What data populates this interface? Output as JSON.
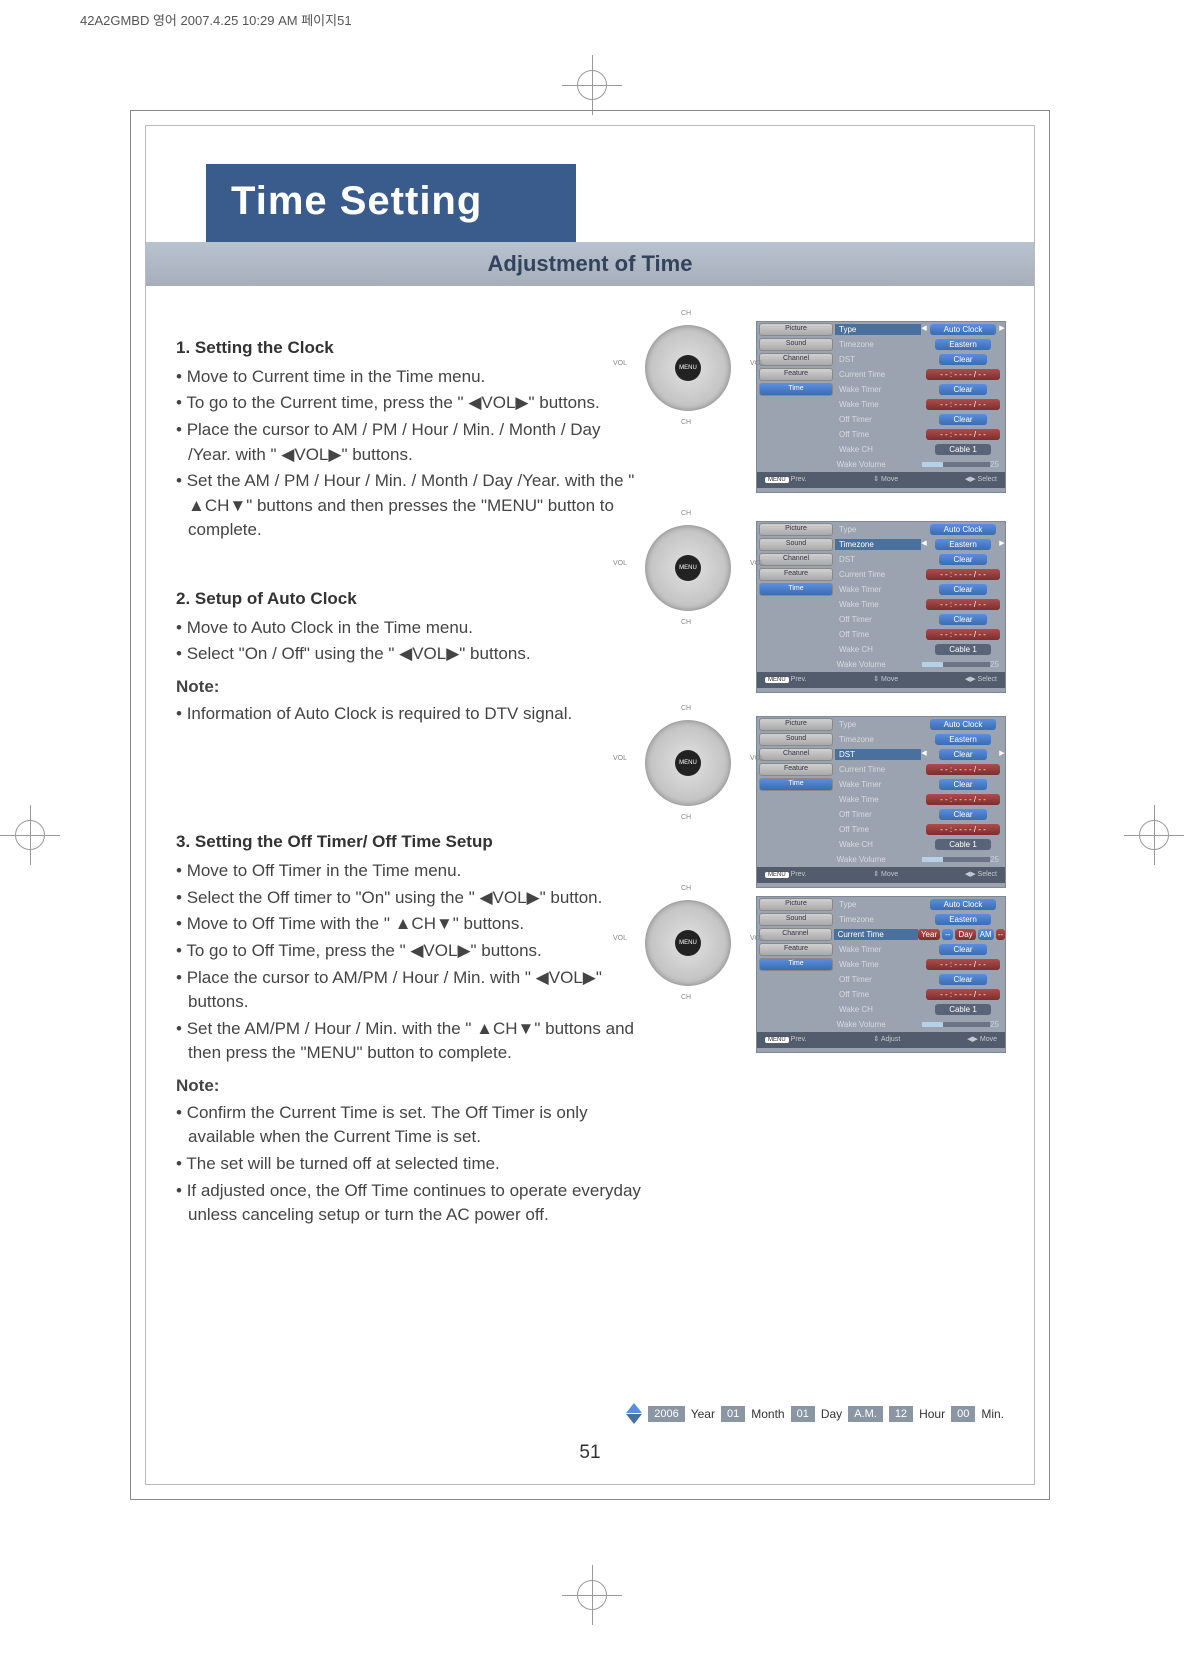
{
  "meta": {
    "header": "42A2GMBD 영어  2007.4.25 10:29 AM 페이지51"
  },
  "title": "Time Setting",
  "subtitle": "Adjustment of Time",
  "sections": {
    "clock": {
      "heading": "1. Setting the Clock",
      "b1": "Move to Current time in the Time menu.",
      "b2": "To go to the Current time, press the \" ◀VOL▶\" buttons.",
      "b3": "Place the cursor to AM / PM / Hour / Min. / Month / Day /Year. with \" ◀VOL▶\" buttons.",
      "b4": "Set the AM / PM / Hour / Min. / Month / Day /Year. with the \" ▲CH▼\" buttons and then presses the \"MENU\" button to complete."
    },
    "auto": {
      "heading": "2. Setup of Auto Clock",
      "b1": "Move to Auto Clock in the Time menu.",
      "b2": "Select \"On / Off\" using the  \" ◀VOL▶\" buttons.",
      "note_label": "Note:",
      "note1": "Information of Auto Clock is required to DTV signal."
    },
    "off": {
      "heading": "3. Setting the Off Timer/ Off Time Setup",
      "b1": "Move to Off Timer in the Time menu.",
      "b2": "Select the Off timer to \"On\" using the \" ◀VOL▶\" button.",
      "b3": "Move to Off Time with the \" ▲CH▼\" buttons.",
      "b4": "To go to Off Time, press the \" ◀VOL▶\" buttons.",
      "b5": "Place the cursor to AM/PM / Hour / Min. with \" ◀VOL▶\" buttons.",
      "b6": "Set the AM/PM / Hour / Min. with the \" ▲CH▼\" buttons and then press the \"MENU\" button to complete.",
      "note_label": "Note:",
      "note1": "Confirm the Current Time is set. The Off Timer is only available when the Current Time is set.",
      "note2": "The set will be turned off at selected time.",
      "note3": "If adjusted once, the Off Time continues to operate everyday unless canceling setup or turn the AC power off."
    }
  },
  "remote": {
    "menu": "MENU",
    "ch": "CH",
    "vol": "VOL"
  },
  "osd": {
    "tabs": {
      "picture": "Picture",
      "sound": "Sound",
      "channel": "Channel",
      "feature": "Feature",
      "time": "Time"
    },
    "rows": {
      "type": "Type",
      "timezone": "Timezone",
      "dst": "DST",
      "current": "Current Time",
      "waketimer": "Wake Timer",
      "waketime": "Wake Time",
      "offtimer": "Off Timer",
      "offtime": "Off Time",
      "wakech": "Wake CH",
      "wakevol": "Wake Volume"
    },
    "vals": {
      "autoclock": "Auto Clock",
      "eastern": "Eastern",
      "clear": "Clear",
      "dashdate": "- - : - -  - - / - -",
      "cable1": "Cable 1",
      "vol": "25"
    },
    "footer": {
      "prev": "Prev.",
      "move": "Move",
      "select": "Select",
      "adjust": "Adjust",
      "menu": "MENU"
    }
  },
  "yearbar": {
    "year_v": "2006",
    "year": "Year",
    "v01a": "01",
    "month": "Month",
    "v01b": "01",
    "day": "Day",
    "ampm": "A.M.",
    "hour_v": "12",
    "hour": "Hour",
    "min_v": "00",
    "min": "Min."
  },
  "page_number": "51"
}
